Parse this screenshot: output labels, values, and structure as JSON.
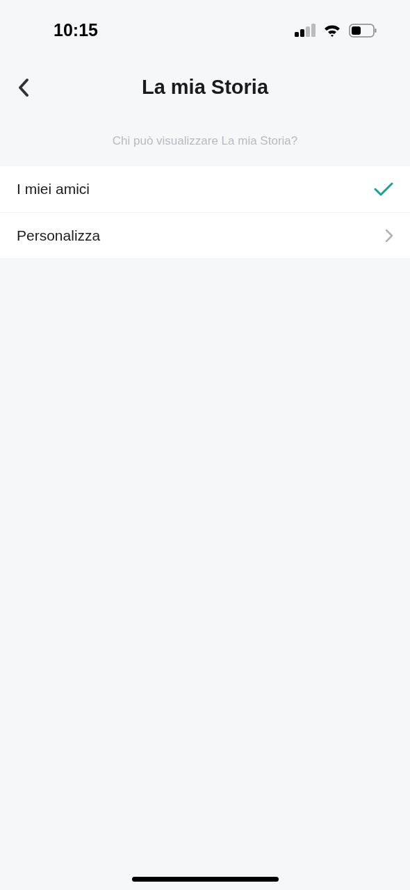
{
  "status_bar": {
    "time": "10:15"
  },
  "header": {
    "title": "La mia Storia"
  },
  "section": {
    "caption": "Chi può visualizzare La mia Storia?"
  },
  "options": [
    {
      "label": "I miei amici",
      "kind": "option",
      "selected": true
    },
    {
      "label": "Personalizza",
      "kind": "nav",
      "selected": false
    }
  ]
}
